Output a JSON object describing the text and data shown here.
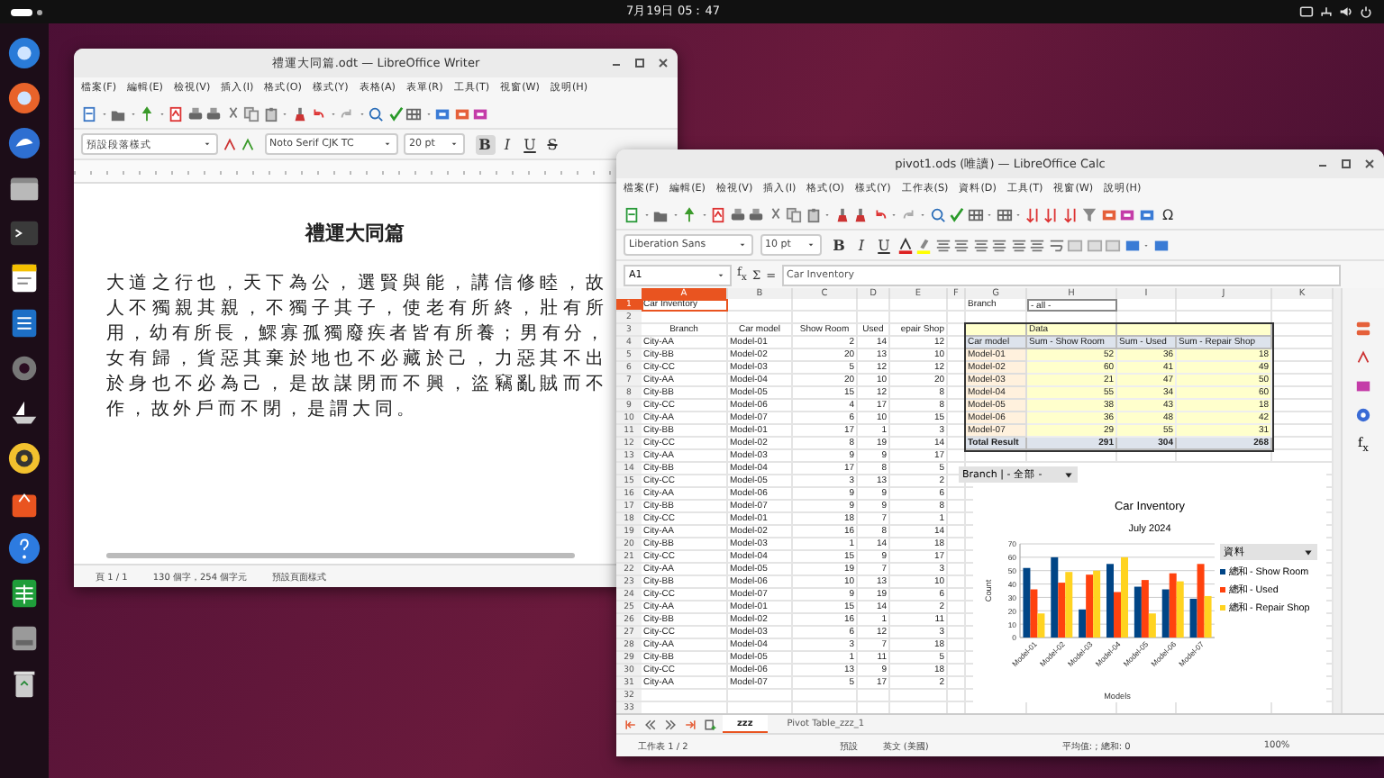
{
  "top_bar": {
    "clock": "7月19日 05：47"
  },
  "writer": {
    "title": "禮運大同篇.odt — LibreOffice Writer",
    "menu": [
      "檔案(F)",
      "編輯(E)",
      "檢視(V)",
      "插入(I)",
      "格式(O)",
      "樣式(Y)",
      "表格(A)",
      "表單(R)",
      "工具(T)",
      "視窗(W)",
      "說明(H)"
    ],
    "paragraph_style": "預設段落樣式",
    "font_name": "Noto Serif CJK TC",
    "font_size": "20 pt",
    "format_buttons": [
      "B",
      "I",
      "U",
      "S"
    ],
    "document": {
      "heading": "禮運大同篇",
      "lines": [
        "大道之行也，天下為公，選賢與能，講信修睦，故",
        "人不獨親其親，不獨子其子，使老有所終，壯有所",
        "用，幼有所長，鰥寡孤獨廢疾者皆有所養；男有分，",
        "女有歸，貨惡其棄於地也不必藏於己，力惡其不出",
        "於身也不必為己，是故謀閉而不興，盜竊亂賊而不",
        "作，故外戶而不閉，是謂大同。"
      ]
    },
    "status_bar": [
      "頁 1 / 1",
      "130 個字，254 個字元",
      "預設頁面樣式"
    ]
  },
  "calc": {
    "title": "pivot1.ods (唯讀) — LibreOffice Calc",
    "menu": [
      "檔案(F)",
      "編輯(E)",
      "檢視(V)",
      "插入(I)",
      "格式(O)",
      "樣式(Y)",
      "工作表(S)",
      "資料(D)",
      "工具(T)",
      "視窗(W)",
      "說明(H)"
    ],
    "font_name": "Liberation Sans",
    "font_size": "10 pt",
    "format_buttons": [
      "B",
      "I",
      "U"
    ],
    "special_character": "Ω",
    "name_box": "A1",
    "function_symbols": [
      "f$_{x}$",
      "Σ",
      "="
    ],
    "formula": "Car Inventory",
    "sidebar_function": "f$_{x}$",
    "columns": [
      {
        "label": "A",
        "selected": true
      },
      {
        "label": "B",
        "selected": false
      },
      {
        "label": "C",
        "selected": false
      },
      {
        "label": "D",
        "selected": false
      },
      {
        "label": "E",
        "selected": false
      },
      {
        "label": "F",
        "selected": false
      },
      {
        "label": "G",
        "selected": false
      },
      {
        "label": "H",
        "selected": false
      },
      {
        "label": "I",
        "selected": false
      },
      {
        "label": "J",
        "selected": false
      },
      {
        "label": "K",
        "selected": false
      }
    ],
    "row_headers": [
      {
        "label": "1",
        "selected": true
      },
      {
        "label": "2",
        "selected": false
      },
      {
        "label": "3",
        "selected": false
      },
      {
        "label": "4",
        "selected": false
      },
      {
        "label": "5",
        "selected": false
      },
      {
        "label": "6",
        "selected": false
      },
      {
        "label": "7",
        "selected": false
      },
      {
        "label": "8",
        "selected": false
      },
      {
        "label": "9",
        "selected": false
      },
      {
        "label": "10",
        "selected": false
      },
      {
        "label": "11",
        "selected": false
      },
      {
        "label": "12",
        "selected": false
      },
      {
        "label": "13",
        "selected": false
      },
      {
        "label": "14",
        "selected": false
      },
      {
        "label": "15",
        "selected": false
      },
      {
        "label": "16",
        "selected": false
      },
      {
        "label": "17",
        "selected": false
      },
      {
        "label": "18",
        "selected": false
      },
      {
        "label": "19",
        "selected": false
      },
      {
        "label": "20",
        "selected": false
      },
      {
        "label": "21",
        "selected": false
      },
      {
        "label": "22",
        "selected": false
      },
      {
        "label": "23",
        "selected": false
      },
      {
        "label": "24",
        "selected": false
      },
      {
        "label": "25",
        "selected": false
      },
      {
        "label": "26",
        "selected": false
      },
      {
        "label": "27",
        "selected": false
      },
      {
        "label": "28",
        "selected": false
      },
      {
        "label": "29",
        "selected": false
      },
      {
        "label": "30",
        "selected": false
      },
      {
        "label": "31",
        "selected": false
      },
      {
        "label": "32",
        "selected": false
      },
      {
        "label": "33",
        "selected": false
      }
    ],
    "title_cell": "Car Inventory",
    "headers": [
      "Branch",
      "Car model",
      "Show Room",
      "Used",
      "epair Shop"
    ],
    "records": [
      [
        "City-AA",
        "Model-01",
        "2",
        "14",
        "12"
      ],
      [
        "City-BB",
        "Model-02",
        "20",
        "13",
        "10"
      ],
      [
        "City-CC",
        "Model-03",
        "5",
        "12",
        "12"
      ],
      [
        "City-AA",
        "Model-04",
        "20",
        "10",
        "20"
      ],
      [
        "City-BB",
        "Model-05",
        "15",
        "12",
        "8"
      ],
      [
        "City-CC",
        "Model-06",
        "4",
        "17",
        "8"
      ],
      [
        "City-AA",
        "Model-07",
        "6",
        "10",
        "15"
      ],
      [
        "City-BB",
        "Model-01",
        "17",
        "1",
        "3"
      ],
      [
        "City-CC",
        "Model-02",
        "8",
        "19",
        "14"
      ],
      [
        "City-AA",
        "Model-03",
        "9",
        "9",
        "17"
      ],
      [
        "City-BB",
        "Model-04",
        "17",
        "8",
        "5"
      ],
      [
        "City-CC",
        "Model-05",
        "3",
        "13",
        "2"
      ],
      [
        "City-AA",
        "Model-06",
        "9",
        "9",
        "6"
      ],
      [
        "City-BB",
        "Model-07",
        "9",
        "9",
        "8"
      ],
      [
        "City-CC",
        "Model-01",
        "18",
        "7",
        "1"
      ],
      [
        "City-AA",
        "Model-02",
        "16",
        "8",
        "14"
      ],
      [
        "City-BB",
        "Model-03",
        "1",
        "14",
        "18"
      ],
      [
        "City-CC",
        "Model-04",
        "15",
        "9",
        "17"
      ],
      [
        "City-AA",
        "Model-05",
        "19",
        "7",
        "3"
      ],
      [
        "City-BB",
        "Model-06",
        "10",
        "13",
        "10"
      ],
      [
        "City-CC",
        "Model-07",
        "9",
        "19",
        "6"
      ],
      [
        "City-AA",
        "Model-01",
        "15",
        "14",
        "2"
      ],
      [
        "City-BB",
        "Model-02",
        "16",
        "1",
        "11"
      ],
      [
        "City-CC",
        "Model-03",
        "6",
        "12",
        "3"
      ],
      [
        "City-AA",
        "Model-04",
        "3",
        "7",
        "18"
      ],
      [
        "City-BB",
        "Model-05",
        "1",
        "11",
        "5"
      ],
      [
        "City-CC",
        "Model-06",
        "13",
        "9",
        "18"
      ],
      [
        "City-AA",
        "Model-07",
        "5",
        "17",
        "2"
      ]
    ],
    "pivot": {
      "filter_label": "Branch",
      "filter_value": "- all -",
      "data_label": "Data",
      "headers": [
        "Car model",
        "Sum - Show Room",
        "Sum - Used",
        "Sum - Repair Shop"
      ],
      "rows": [
        [
          "Model-01",
          "52",
          "36",
          "18"
        ],
        [
          "Model-02",
          "60",
          "41",
          "49"
        ],
        [
          "Model-03",
          "21",
          "47",
          "50"
        ],
        [
          "Model-04",
          "55",
          "34",
          "60"
        ],
        [
          "Model-05",
          "38",
          "43",
          "18"
        ],
        [
          "Model-06",
          "36",
          "48",
          "42"
        ],
        [
          "Model-07",
          "29",
          "55",
          "31"
        ]
      ],
      "total": [
        "Total Result",
        "291",
        "304",
        "268"
      ]
    },
    "chart": {
      "field_button": "Branch | - 全部 -",
      "subtitle": "July 2024",
      "legend_header": "資料",
      "chart_data": {
        "type": "bar",
        "title": "Car Inventory",
        "xlabel": "Models",
        "ylabel": "Count",
        "categories": [
          "Model-01",
          "Model-02",
          "Model-03",
          "Model-04",
          "Model-05",
          "Model-06",
          "Model-07"
        ],
        "ylim": [
          0,
          70
        ],
        "grid": true,
        "legend": true,
        "yticks": [
          0,
          10,
          20,
          30,
          40,
          50,
          60,
          70
        ],
        "series": [
          {
            "name": "總和 - Show Room",
            "color": "#004586",
            "values": [
              52,
              60,
              21,
              55,
              38,
              36,
              29
            ]
          },
          {
            "name": "總和 - Used",
            "color": "#ff420e",
            "values": [
              36,
              41,
              47,
              34,
              43,
              48,
              55
            ]
          },
          {
            "name": "總和 - Repair Shop",
            "color": "#ffd320",
            "values": [
              18,
              49,
              50,
              60,
              18,
              42,
              31
            ]
          }
        ]
      }
    },
    "sheet_tabs": [
      {
        "label": "zzz",
        "selected": true
      },
      {
        "label": "Pivot Table_zzz_1",
        "selected": false
      }
    ],
    "status_bar": [
      "工作表 1 / 2",
      "預設",
      "英文 (美國)",
      "平均值: ; 總和: 0",
      "100%"
    ]
  }
}
